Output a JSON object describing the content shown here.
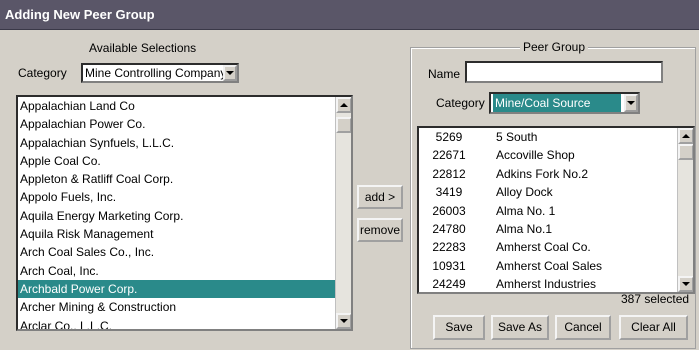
{
  "window": {
    "title": "Adding New Peer Group"
  },
  "available": {
    "heading": "Available Selections",
    "category_label": "Category",
    "category_value": "Mine Controlling Company",
    "items": [
      "Appalachian Land Co",
      "Appalachian Power Co.",
      "Appalachian Synfuels, L.L.C.",
      "Apple Coal Co.",
      "Appleton & Ratliff Coal Corp.",
      "Appolo Fuels, Inc.",
      "Aquila Energy Marketing Corp.",
      "Aquila Risk Management",
      "Arch Coal Sales Co., Inc.",
      "Arch Coal, Inc.",
      "Archbald Power Corp.",
      "Archer Mining & Construction",
      "Arclar Co., L.L.C."
    ],
    "selected_index": 10
  },
  "actions": {
    "add_label": "add >",
    "remove_label": "remove"
  },
  "peer_group": {
    "heading": "Peer Group",
    "name_label": "Name",
    "name_value": "",
    "category_label": "Category",
    "category_value": "Mine/Coal Source",
    "rows": [
      {
        "id": "5269",
        "name": "5 South"
      },
      {
        "id": "22671",
        "name": "Accoville Shop"
      },
      {
        "id": "22812",
        "name": "Adkins Fork No.2"
      },
      {
        "id": "3419",
        "name": "Alloy Dock"
      },
      {
        "id": "26003",
        "name": "Alma No. 1"
      },
      {
        "id": "24780",
        "name": "Alma No.1"
      },
      {
        "id": "22283",
        "name": "Amherst Coal Co."
      },
      {
        "id": "10931",
        "name": "Amherst Coal Sales"
      },
      {
        "id": "24249",
        "name": "Amherst Industries"
      }
    ],
    "selected_count_text": "387 selected",
    "save_label": "Save",
    "save_as_label": "Save As",
    "cancel_label": "Cancel",
    "clear_all_label": "Clear All"
  },
  "colors": {
    "title_bg": "#5a5668",
    "selection": "#2a8a8a",
    "background": "#d4d0c8"
  }
}
